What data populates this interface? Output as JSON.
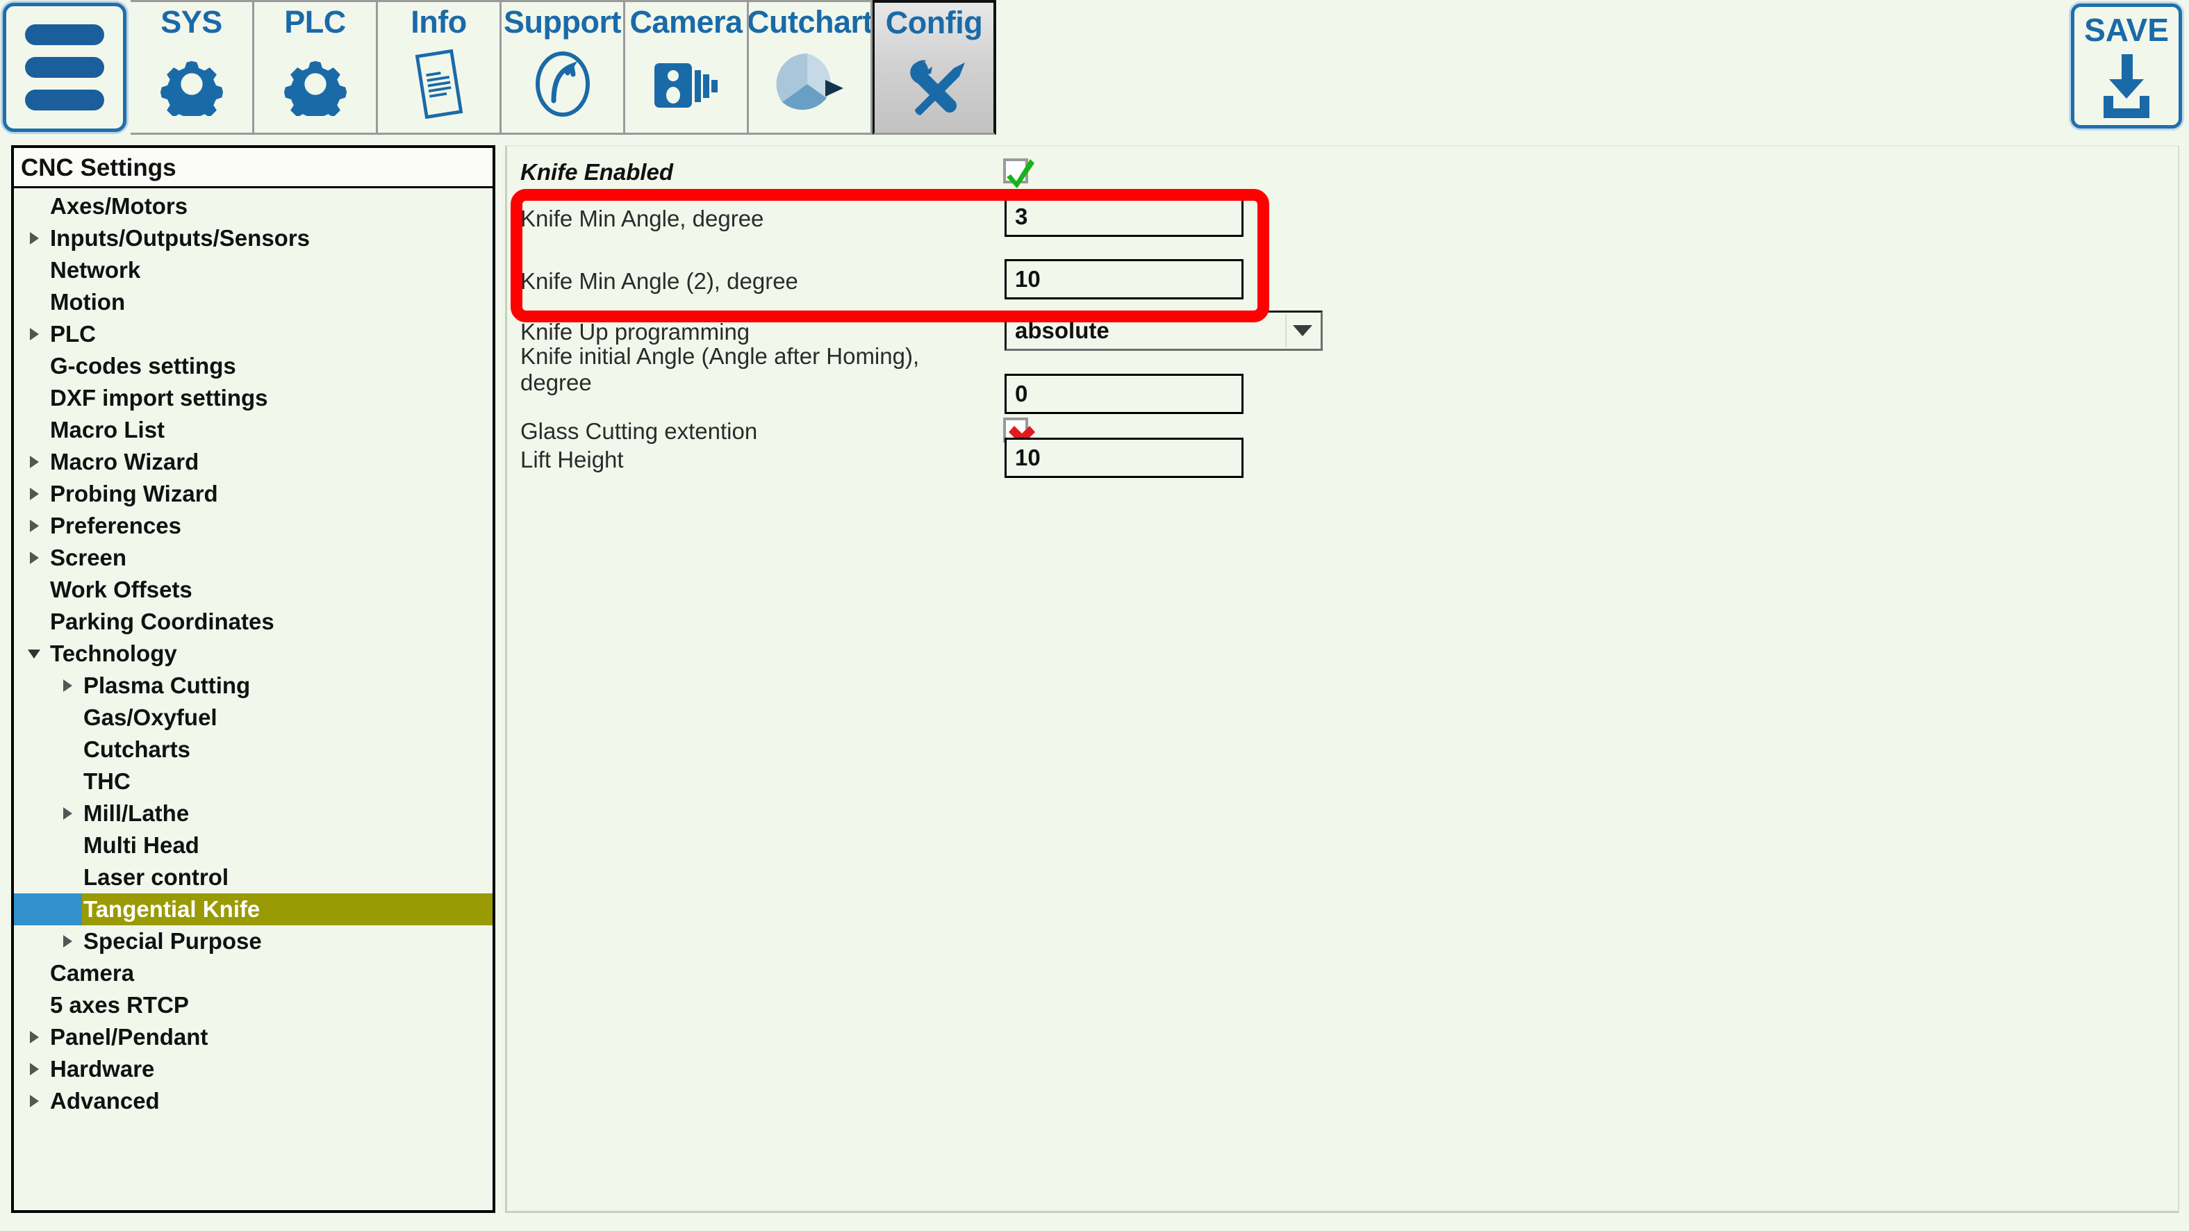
{
  "topbar": {
    "menu_button": {
      "name": "hamburger-menu"
    },
    "tabs": [
      {
        "label": "SYS",
        "icon": "gear-icon",
        "selected": false
      },
      {
        "label": "PLC",
        "icon": "gear-icon",
        "selected": false
      },
      {
        "label": "Info",
        "icon": "document-icon",
        "selected": false
      },
      {
        "label": "Support",
        "icon": "phone-dial-icon",
        "selected": false
      },
      {
        "label": "Camera",
        "icon": "camera-icon",
        "selected": false
      },
      {
        "label": "Cutchart",
        "icon": "pie-chart-icon",
        "selected": false
      },
      {
        "label": "Config",
        "icon": "tools-icon",
        "selected": true
      }
    ],
    "save_button": {
      "label": "SAVE",
      "icon": "download-save-icon"
    }
  },
  "sidebar": {
    "title": "CNC Settings",
    "items": [
      {
        "label": "Axes/Motors",
        "level": 0,
        "arrow": "none",
        "selected": false
      },
      {
        "label": "Inputs/Outputs/Sensors",
        "level": 0,
        "arrow": "collapsed",
        "selected": false
      },
      {
        "label": "Network",
        "level": 0,
        "arrow": "none",
        "selected": false
      },
      {
        "label": "Motion",
        "level": 0,
        "arrow": "none",
        "selected": false
      },
      {
        "label": "PLC",
        "level": 0,
        "arrow": "collapsed",
        "selected": false
      },
      {
        "label": "G-codes settings",
        "level": 0,
        "arrow": "none",
        "selected": false
      },
      {
        "label": "DXF import settings",
        "level": 0,
        "arrow": "none",
        "selected": false
      },
      {
        "label": "Macro List",
        "level": 0,
        "arrow": "none",
        "selected": false
      },
      {
        "label": "Macro Wizard",
        "level": 0,
        "arrow": "collapsed",
        "selected": false
      },
      {
        "label": "Probing Wizard",
        "level": 0,
        "arrow": "collapsed",
        "selected": false
      },
      {
        "label": "Preferences",
        "level": 0,
        "arrow": "collapsed",
        "selected": false
      },
      {
        "label": "Screen",
        "level": 0,
        "arrow": "collapsed",
        "selected": false
      },
      {
        "label": "Work Offsets",
        "level": 0,
        "arrow": "none",
        "selected": false
      },
      {
        "label": "Parking Coordinates",
        "level": 0,
        "arrow": "none",
        "selected": false
      },
      {
        "label": "Technology",
        "level": 0,
        "arrow": "expanded",
        "selected": false
      },
      {
        "label": "Plasma Cutting",
        "level": 1,
        "arrow": "collapsed",
        "selected": false
      },
      {
        "label": "Gas/Oxyfuel",
        "level": 1,
        "arrow": "none",
        "selected": false
      },
      {
        "label": "Cutcharts",
        "level": 1,
        "arrow": "none",
        "selected": false
      },
      {
        "label": "THC",
        "level": 1,
        "arrow": "none",
        "selected": false
      },
      {
        "label": "Mill/Lathe",
        "level": 1,
        "arrow": "collapsed",
        "selected": false
      },
      {
        "label": "Multi Head",
        "level": 1,
        "arrow": "none",
        "selected": false
      },
      {
        "label": "Laser control",
        "level": 1,
        "arrow": "none",
        "selected": false
      },
      {
        "label": "Tangential Knife",
        "level": 1,
        "arrow": "none",
        "selected": true
      },
      {
        "label": "Special Purpose",
        "level": 1,
        "arrow": "collapsed",
        "selected": false
      },
      {
        "label": "Camera",
        "level": 0,
        "arrow": "none",
        "selected": false
      },
      {
        "label": "5 axes RTCP",
        "level": 0,
        "arrow": "none",
        "selected": false
      },
      {
        "label": "Panel/Pendant",
        "level": 0,
        "arrow": "collapsed",
        "selected": false
      },
      {
        "label": "Hardware",
        "level": 0,
        "arrow": "collapsed",
        "selected": false
      },
      {
        "label": "Advanced",
        "level": 0,
        "arrow": "collapsed",
        "selected": false
      }
    ],
    "selected_item": "Tangential Knife",
    "colors": {
      "selected_row": "#9a9a05",
      "selected_indent": "#3391cc"
    }
  },
  "form": {
    "rows": [
      {
        "label": "Knife Enabled",
        "control": "checkbox",
        "value": "checked"
      },
      {
        "label": "Knife Min Angle, degree",
        "control": "text",
        "value": "3"
      },
      {
        "label": "Knife Min Angle (2), degree",
        "control": "text",
        "value": "10"
      },
      {
        "label": "Knife Up programming",
        "control": "select",
        "value": "absolute"
      },
      {
        "label": "Knife initial Angle (Angle after Homing), degree",
        "control": "text",
        "value": "0"
      },
      {
        "label": "Glass Cutting extention",
        "control": "checkbox",
        "value": "unchecked"
      },
      {
        "label": "Lift Height",
        "control": "text",
        "value": "10"
      }
    ]
  },
  "annotation": {
    "type": "red-rounded-rectangle",
    "color": "#ff0000",
    "highlights": [
      "Knife Min Angle, degree",
      "Knife Min Angle (2), degree"
    ]
  }
}
